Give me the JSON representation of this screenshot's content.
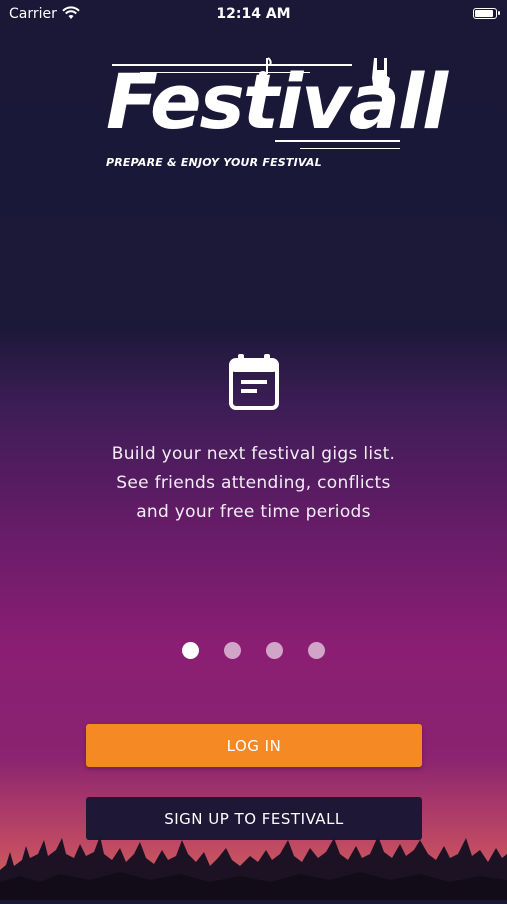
{
  "status_bar": {
    "carrier": "Carrier",
    "time": "12:14 AM"
  },
  "logo": {
    "wordmark": "Festivall",
    "tagline": "PREPARE & ENJOY YOUR FESTIVAL"
  },
  "onboarding": {
    "icon": "calendar-icon",
    "lines": [
      "Build your next festival gigs list.",
      "See friends attending, conflicts",
      "and your free time periods"
    ],
    "page_count": 4,
    "active_page": 1
  },
  "buttons": {
    "login": "LOG IN",
    "signup": "SIGN UP TO FESTIVALL"
  },
  "colors": {
    "accent": "#f58a25",
    "signup_bg": "#1e1735",
    "bg_top": "#1a1737",
    "bg_mid": "#8b1e73"
  }
}
